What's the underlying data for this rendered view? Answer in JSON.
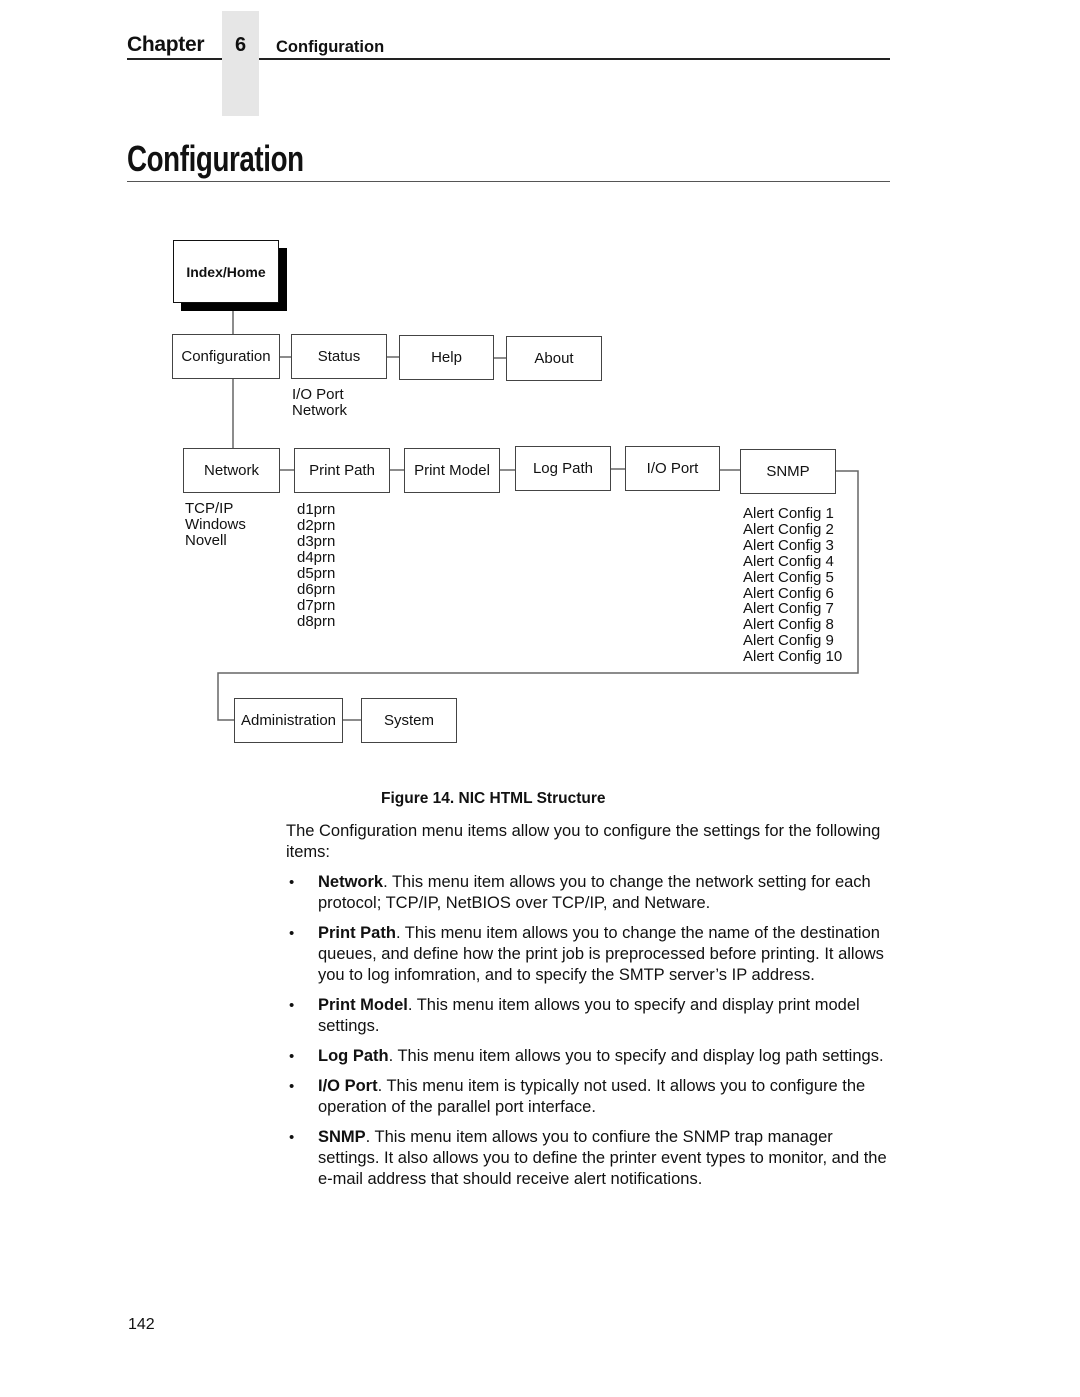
{
  "header": {
    "chapter_label": "Chapter",
    "chapter_number": "6",
    "chapter_title": "Configuration"
  },
  "page_title": "Configuration",
  "figure": {
    "nodes": {
      "index_home": "Index/Home",
      "configuration": "Configuration",
      "status": "Status",
      "help": "Help",
      "about": "About",
      "network": "Network",
      "print_path": "Print Path",
      "print_model": "Print Model",
      "log_path": "Log Path",
      "io_port": "I/O Port",
      "snmp": "SNMP",
      "administration": "Administration",
      "system": "System"
    },
    "status_children": [
      "I/O Port",
      "Network"
    ],
    "network_children": [
      "TCP/IP",
      "Windows",
      "Novell"
    ],
    "print_path_children": [
      "d1prn",
      "d2prn",
      "d3prn",
      "d4prn",
      "d5prn",
      "d6prn",
      "d7prn",
      "d8prn"
    ],
    "snmp_children": [
      "Alert Config 1",
      "Alert Config 2",
      "Alert Config 3",
      "Alert Config 4",
      "Alert Config 5",
      "Alert Config 6",
      "Alert Config 7",
      "Alert Config 8",
      "Alert Config 9",
      "Alert Config 10"
    ],
    "caption": "Figure 14. NIC HTML Structure"
  },
  "body": {
    "intro": "The Configuration menu items allow you to configure the settings for the following items:",
    "bullets": [
      {
        "term": "Network",
        "text": ". This menu item allows you to change the network setting for each protocol; TCP/IP, NetBIOS over TCP/IP, and Netware."
      },
      {
        "term": "Print Path",
        "text": ". This menu item allows you to change the name of the destination queues, and define how the print job is preprocessed before printing. It allows you to log infomration, and to specify the SMTP server’s IP address."
      },
      {
        "term": "Print Model",
        "text": ". This menu item allows you to specify and display print model settings."
      },
      {
        "term": "Log Path",
        "text": ". This menu item allows you to specify and display log path settings."
      },
      {
        "term": "I/O Port",
        "text": ". This menu item is typically not used. It allows you to configure the operation of the parallel port interface."
      },
      {
        "term": "SNMP",
        "text": ". This menu item allows you to confiure the SNMP trap manager settings. It also allows you to define the printer event types to monitor, and the e-mail address that should receive alert notifications."
      }
    ]
  },
  "footer": {
    "page_number": "142"
  }
}
